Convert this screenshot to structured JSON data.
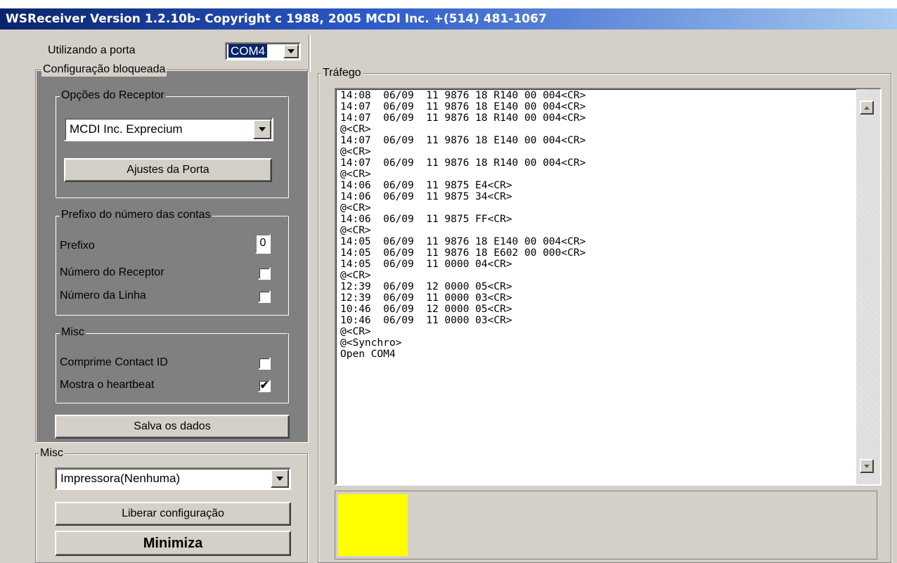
{
  "title": "WSReceiver Version 1.2.10b- Copyright c 1988, 2005 MCDI Inc.  +(514) 481-1067",
  "port": {
    "label": "Utilizando a porta",
    "value": "COM4"
  },
  "locked_config": {
    "title": "Configuração bloqueada",
    "receiver_options": {
      "title": "Opções do Receptor",
      "receiver_value": "MCDI Inc. Exprecium",
      "port_settings_label": "Ajustes da Porta"
    },
    "account_prefix": {
      "title": "Prefixo do número das contas",
      "prefix_label": "Prefixo",
      "prefix_value": "0",
      "receiver_number_label": "Número do Receptor",
      "line_number_label": "Número da Linha"
    },
    "misc": {
      "title": "Misc",
      "compress_label": "Comprime Contact ID",
      "heartbeat_label": "Mostra o heartbeat",
      "heartbeat_check": "✔"
    },
    "save_label": "Salva os dados"
  },
  "misc2": {
    "title": "Misc",
    "printer_value": "Impressora(Nenhuma)",
    "release_label": "Liberar configuração",
    "minimize_label": "Minimiza"
  },
  "traffic": {
    "title": "Tráfego",
    "text": "14:08  06/09  11 9876 18 R140 00 004<CR>\n14:07  06/09  11 9876 18 E140 00 004<CR>\n14:07  06/09  11 9876 18 R140 00 004<CR>\n@<CR>\n14:07  06/09  11 9876 18 E140 00 004<CR>\n@<CR>\n14:07  06/09  11 9876 18 R140 00 004<CR>\n@<CR>\n14:06  06/09  11 9875 E4<CR>\n14:06  06/09  11 9875 34<CR>\n@<CR>\n14:06  06/09  11 9875 FF<CR>\n@<CR>\n14:05  06/09  11 9876 18 E140 00 004<CR>\n14:05  06/09  11 9876 18 E602 00 000<CR>\n14:05  06/09  11 0000 04<CR>\n@<CR>\n12:39  06/09  12 0000 05<CR>\n12:39  06/09  11 0000 03<CR>\n10:46  06/09  12 0000 05<CR>\n10:46  06/09  11 0000 03<CR>\n@<CR>\n@<Synchro>\nOpen COM4"
  },
  "colors": {
    "indicator": "#ffff00",
    "panel": "#808080",
    "face": "#d4d0c8"
  }
}
